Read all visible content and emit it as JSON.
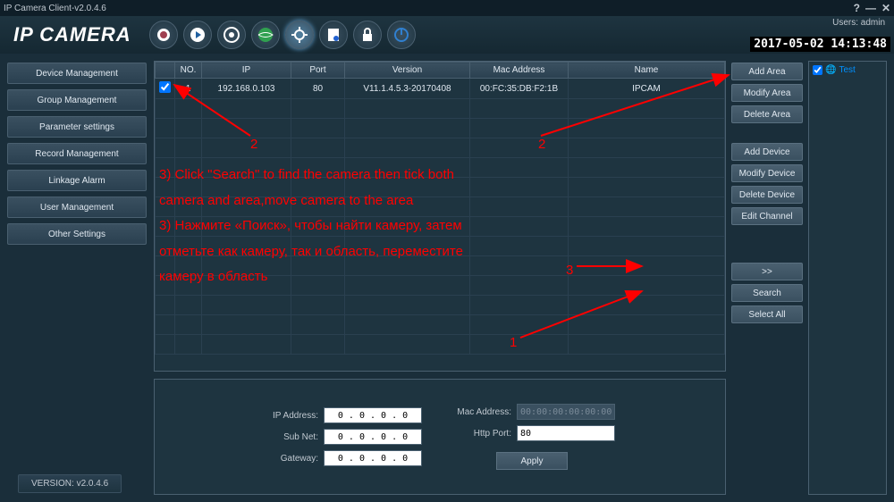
{
  "window": {
    "title": "IP Camera Client-v2.0.4.6"
  },
  "logo": "IP CAMERA",
  "user": {
    "label": "Users: admin"
  },
  "datetime": "2017-05-02 14:13:48",
  "sidebar": {
    "items": [
      "Device Management",
      "Group Management",
      "Parameter settings",
      "Record Management",
      "Linkage Alarm",
      "User Management",
      "Other Settings"
    ]
  },
  "version": "VERSION: v2.0.4.6",
  "table": {
    "headers": {
      "check": "",
      "no": "NO.",
      "ip": "IP",
      "port": "Port",
      "version": "Version",
      "mac": "Mac Address",
      "name": "Name"
    },
    "rows": [
      {
        "no": "1",
        "ip": "192.168.0.103",
        "port": "80",
        "version": "V11.1.4.5.3-20170408",
        "mac": "00:FC:35:DB:F2:1B",
        "name": "IPCAM"
      }
    ]
  },
  "actions": {
    "add_area": "Add Area",
    "modify_area": "Modify Area",
    "delete_area": "Delete Area",
    "add_device": "Add Device",
    "modify_device": "Modify Device",
    "delete_device": "Delete Device",
    "edit_channel": "Edit Channel",
    "move": ">>",
    "search": "Search",
    "select_all": "Select All"
  },
  "tree": {
    "root": "Test"
  },
  "details": {
    "ip_label": "IP Address:",
    "ip_value": "0 . 0 . 0 . 0",
    "subnet_label": "Sub Net:",
    "subnet_value": "0 . 0 . 0 . 0",
    "gateway_label": "Gateway:",
    "gateway_value": "0 . 0 . 0 . 0",
    "mac_label": "Mac Address:",
    "mac_value": "00:00:00:00:00:00",
    "http_label": "Http Port:",
    "http_value": "80",
    "apply": "Apply"
  },
  "annotations": {
    "text_en": "3) Click \"Search\" to find the camera then tick both",
    "text_en2": "camera and area,move camera to the area",
    "text_ru": "3) Нажмите «Поиск», чтобы найти камеру, затем",
    "text_ru2": "отметьте как камеру, так и область, переместите",
    "text_ru3": "камеру в область",
    "label1": "1",
    "label2a": "2",
    "label2b": "2",
    "label3": "3"
  }
}
